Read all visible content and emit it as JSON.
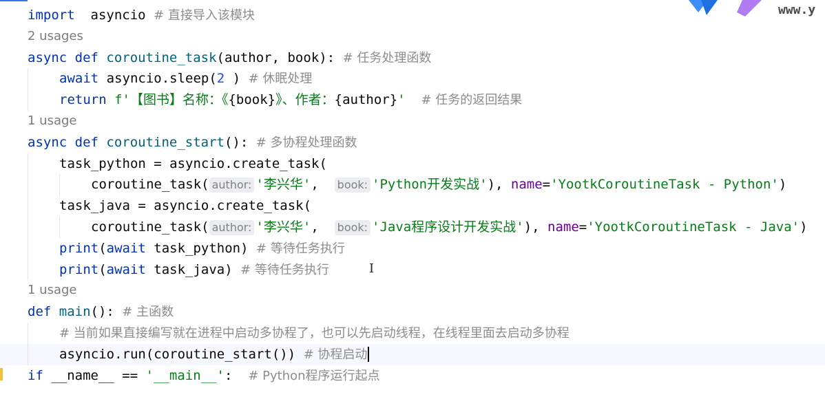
{
  "watermark": "www.y",
  "lines": [
    {
      "kind": "code",
      "parts": [
        [
          "kw",
          "import"
        ],
        [
          "",
          "  asyncio "
        ],
        [
          "cmt",
          "# 直接导入该模块"
        ]
      ]
    },
    {
      "kind": "hint",
      "text": "2 usages"
    },
    {
      "kind": "code",
      "parts": [
        [
          "kw",
          "async def "
        ],
        [
          "fn",
          "coroutine_task"
        ],
        [
          "",
          "(author, book): "
        ],
        [
          "cmt",
          "# 任务处理函数"
        ]
      ]
    },
    {
      "kind": "code",
      "indent": 1,
      "parts": [
        [
          "kw",
          "await "
        ],
        [
          "",
          "asyncio.sleep("
        ],
        [
          "num",
          "2"
        ],
        [
          "",
          " ) "
        ],
        [
          "cmt",
          "# 休眠处理"
        ]
      ]
    },
    {
      "kind": "code",
      "indent": 1,
      "parts": [
        [
          "kw",
          "return "
        ],
        [
          "str",
          "f'【图书】名称：《"
        ],
        [
          "",
          "{book}"
        ],
        [
          "str",
          "》、作者："
        ],
        [
          "",
          "{author}"
        ],
        [
          "str",
          "'"
        ],
        [
          "",
          "  "
        ],
        [
          "cmt",
          "# 任务的返回结果"
        ]
      ]
    },
    {
      "kind": "hint",
      "text": "1 usage"
    },
    {
      "kind": "code",
      "parts": [
        [
          "kw",
          "async def "
        ],
        [
          "fn",
          "coroutine_start"
        ],
        [
          "",
          "(): "
        ],
        [
          "cmt",
          "# 多协程处理函数"
        ]
      ]
    },
    {
      "kind": "code",
      "indent": 1,
      "parts": [
        [
          "",
          "task_python = asyncio.create_task("
        ]
      ]
    },
    {
      "kind": "code",
      "indent": 2,
      "parts": [
        [
          "",
          "coroutine_task("
        ],
        [
          "inlay",
          "author:"
        ],
        [
          "str",
          "'李兴华'"
        ],
        [
          "",
          ",  "
        ],
        [
          "inlay",
          "book:"
        ],
        [
          "str",
          "'Python开发实战'"
        ],
        [
          "",
          "), "
        ],
        [
          "named",
          "name"
        ],
        [
          "",
          "="
        ],
        [
          "str",
          "'YootkCoroutineTask - Python'"
        ],
        [
          "",
          ")"
        ]
      ]
    },
    {
      "kind": "code",
      "indent": 1,
      "parts": [
        [
          "",
          "task_java = asyncio.create_task("
        ]
      ]
    },
    {
      "kind": "code",
      "indent": 2,
      "parts": [
        [
          "",
          "coroutine_task("
        ],
        [
          "inlay",
          "author:"
        ],
        [
          "str",
          "'李兴华'"
        ],
        [
          "",
          ",  "
        ],
        [
          "inlay",
          "book:"
        ],
        [
          "str",
          "'Java程序设计开发实战'"
        ],
        [
          "",
          "), "
        ],
        [
          "named",
          "name"
        ],
        [
          "",
          "="
        ],
        [
          "str",
          "'YootkCoroutineTask - Java'"
        ],
        [
          "",
          ")"
        ]
      ]
    },
    {
      "kind": "code",
      "indent": 1,
      "parts": [
        [
          "kw",
          "print"
        ],
        [
          "",
          "("
        ],
        [
          "kw",
          "await "
        ],
        [
          "",
          "task_python) "
        ],
        [
          "cmt",
          "# 等待任务执行"
        ]
      ]
    },
    {
      "kind": "code",
      "indent": 1,
      "parts": [
        [
          "kw",
          "print"
        ],
        [
          "",
          "("
        ],
        [
          "kw",
          "await "
        ],
        [
          "",
          "task_java) "
        ],
        [
          "cmt",
          "# 等待任务执行"
        ]
      ]
    },
    {
      "kind": "hint",
      "text": "1 usage"
    },
    {
      "kind": "code",
      "parts": [
        [
          "kw",
          "def "
        ],
        [
          "fn",
          "main"
        ],
        [
          "",
          "(): "
        ],
        [
          "cmt",
          "# 主函数"
        ]
      ]
    },
    {
      "kind": "code",
      "indent": 1,
      "parts": [
        [
          "cmt",
          "# 当前如果直接编写就在进程中启动多协程了，也可以先启动线程，在线程里面去启动多协程"
        ]
      ]
    },
    {
      "kind": "code",
      "indent": 1,
      "current": true,
      "parts": [
        [
          "",
          "asyncio.run(coroutine_start()) "
        ],
        [
          "cmt",
          "# 协程启动"
        ],
        [
          "caret",
          ""
        ]
      ]
    },
    {
      "kind": "code",
      "parts": [
        [
          "kw",
          "if "
        ],
        [
          "",
          "__name__ == "
        ],
        [
          "str",
          "'__main__'"
        ],
        [
          "",
          ":  "
        ],
        [
          "cmt",
          "# Python程序运行起点"
        ]
      ]
    }
  ]
}
